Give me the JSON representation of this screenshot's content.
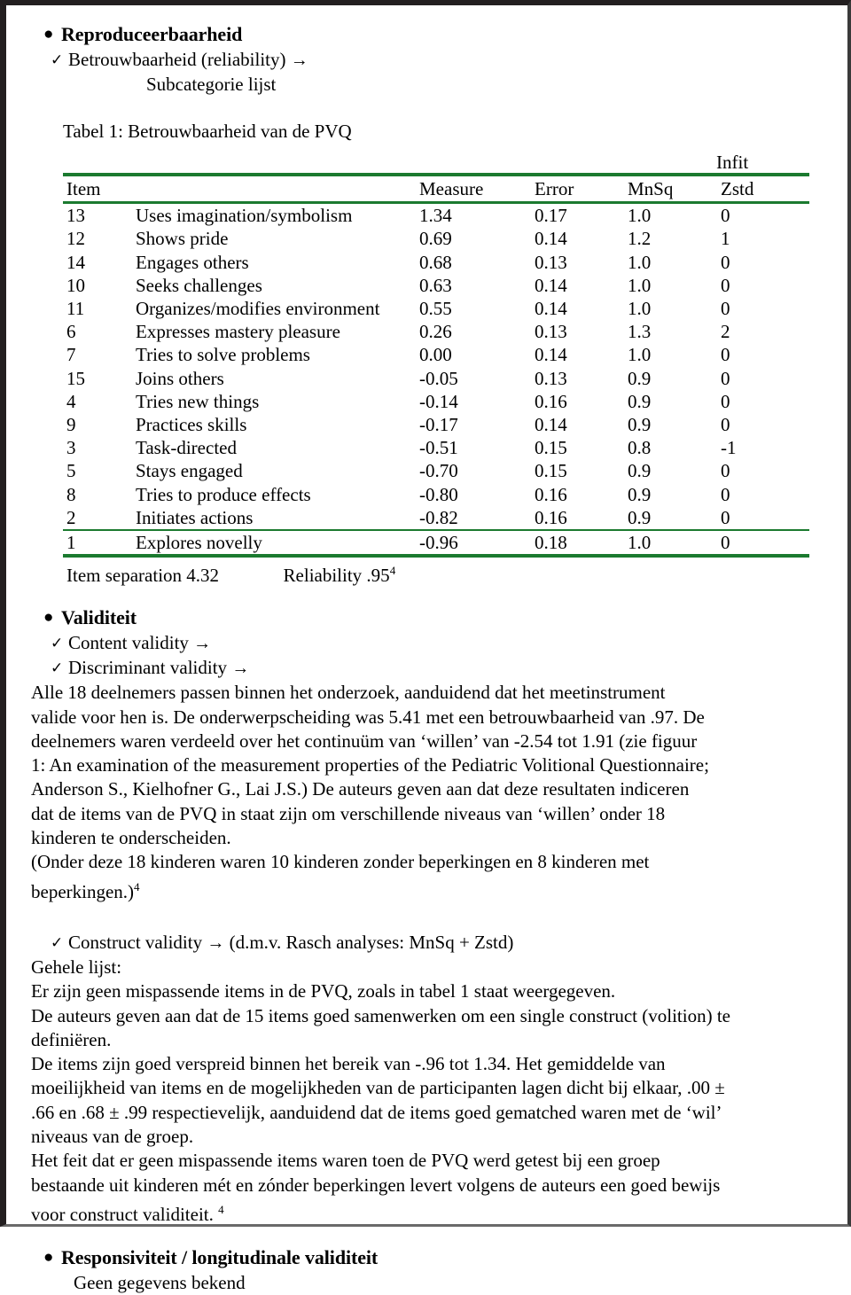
{
  "sections": {
    "reproduceerbaarheid": {
      "title": "Reproduceerbaarheid",
      "check1": "Betrouwbaarheid (reliability)",
      "arrow": "→",
      "check_mark": "✓",
      "bullet_dot": "●",
      "sub1": "Subcategorie lijst"
    },
    "validiteit": {
      "title": "Validiteit",
      "check1": "Content validity",
      "check2": "Discriminant validity",
      "paragraph1": "Alle 18 deelnemers passen binnen het onderzoek, aanduidend dat het meetinstrument valide voor hen is. De onderwerpscheiding was 5.41 met een betrouwbaarheid van .97. De deelnemers waren verdeeld over het continuüm van ‘willen’ van -2.54 tot 1.91 (zie figuur 1: An examination of the measurement properties of the Pediatric Volitional Questionnaire; Anderson S., Kielhofner G., Lai J.S.) De auteurs geven aan dat deze resultaten indiceren dat de items van de PVQ in staat zijn om verschillende niveaus van ‘willen’ onder 18 kinderen te onderscheiden.",
      "paragraph2": "(Onder deze 18 kinderen waren 10 kinderen zonder beperkingen en 8 kinderen met beperkingen.)",
      "paragraph2_footnote": "4"
    },
    "construct": {
      "check_label": "Construct validity",
      "check_suffix": "(d.m.v. Rasch analyses: MnSq + Zstd)",
      "subhead": "Gehele lijst:",
      "paragraph1": "Er zijn geen mispassende items in de PVQ, zoals in tabel 1 staat weergegeven.",
      "paragraph2": "De auteurs geven aan dat de 15 items goed samenwerken om een single construct (volition) te definiëren.",
      "paragraph3": "De items zijn goed verspreid binnen het bereik van -.96 tot 1.34. Het gemiddelde van moeilijkheid van items en de mogelijkheden van de participanten lagen dicht bij elkaar, .00 ± .66 en .68 ± .99 respectievelijk, aanduidend dat de items goed gematched waren met de ‘wil’ niveaus van de groep.",
      "paragraph4": "Het feit dat er geen mispassende items waren toen de PVQ werd getest bij een groep bestaande uit kinderen mét en zónder beperkingen levert volgens de auteurs een goed bewijs voor construct validiteit.",
      "paragraph4_footnote": "4"
    },
    "responsiviteit": {
      "title": "Responsiviteit / longitudinale validiteit",
      "body": "Geen gegevens bekend"
    }
  },
  "table": {
    "caption": "Tabel 1: Betrouwbaarheid van de PVQ",
    "group_header": "Infit",
    "rule_color": "#1b7a2f",
    "columns": [
      "Item",
      "",
      "Measure",
      "Error",
      "MnSq",
      "Zstd"
    ],
    "rows": [
      {
        "item": "13",
        "name": "Uses imagination/symbolism",
        "measure": "1.34",
        "error": "0.17",
        "mnsq": "1.0",
        "zstd": "0"
      },
      {
        "item": "12",
        "name": "Shows pride",
        "measure": "0.69",
        "error": "0.14",
        "mnsq": "1.2",
        "zstd": "1"
      },
      {
        "item": "14",
        "name": "Engages others",
        "measure": "0.68",
        "error": "0.13",
        "mnsq": "1.0",
        "zstd": "0"
      },
      {
        "item": "10",
        "name": "Seeks challenges",
        "measure": "0.63",
        "error": "0.14",
        "mnsq": "1.0",
        "zstd": "0"
      },
      {
        "item": "11",
        "name": " Organizes/modifies environment",
        "measure": "0.55",
        "error": "0.14",
        "mnsq": "1.0",
        "zstd": "0"
      },
      {
        "item": "6",
        "name": "Expresses mastery pleasure",
        "measure": "0.26",
        "error": "0.13",
        "mnsq": "1.3",
        "zstd": "2"
      },
      {
        "item": "7",
        "name": "Tries to solve problems",
        "measure": "0.00",
        "error": "0.14",
        "mnsq": "1.0",
        "zstd": "0"
      },
      {
        "item": "15",
        "name": "Joins others",
        "measure": "-0.05",
        "error": "0.13",
        "mnsq": "0.9",
        "zstd": "0"
      },
      {
        "item": "4",
        "name": "Tries new things",
        "measure": "-0.14",
        "error": "0.16",
        "mnsq": "0.9",
        "zstd": "0"
      },
      {
        "item": "9",
        "name": "Practices skills",
        "measure": "-0.17",
        "error": "0.14",
        "mnsq": "0.9",
        "zstd": "0"
      },
      {
        "item": "3",
        "name": "Task-directed",
        "measure": "-0.51",
        "error": "0.15",
        "mnsq": "0.8",
        "zstd": "-1"
      },
      {
        "item": "5",
        "name": "Stays engaged",
        "measure": "-0.70",
        "error": "0.15",
        "mnsq": "0.9",
        "zstd": "0"
      },
      {
        "item": "8",
        "name": "Tries to produce effects",
        "measure": "-0.80",
        "error": "0.16",
        "mnsq": "0.9",
        "zstd": "0"
      },
      {
        "item": "2",
        "name": "Initiates actions",
        "measure": "-0.82",
        "error": "0.16",
        "mnsq": "0.9",
        "zstd": "0"
      }
    ],
    "last_row": {
      "item": "1",
      "name": "Explores novelly",
      "measure": "-0.96",
      "error": "0.18",
      "mnsq": "1.0",
      "zstd": "0"
    },
    "footer_separation": "Item separation 4.32",
    "footer_reliability": "Reliability .95",
    "footer_footnote": "4"
  }
}
